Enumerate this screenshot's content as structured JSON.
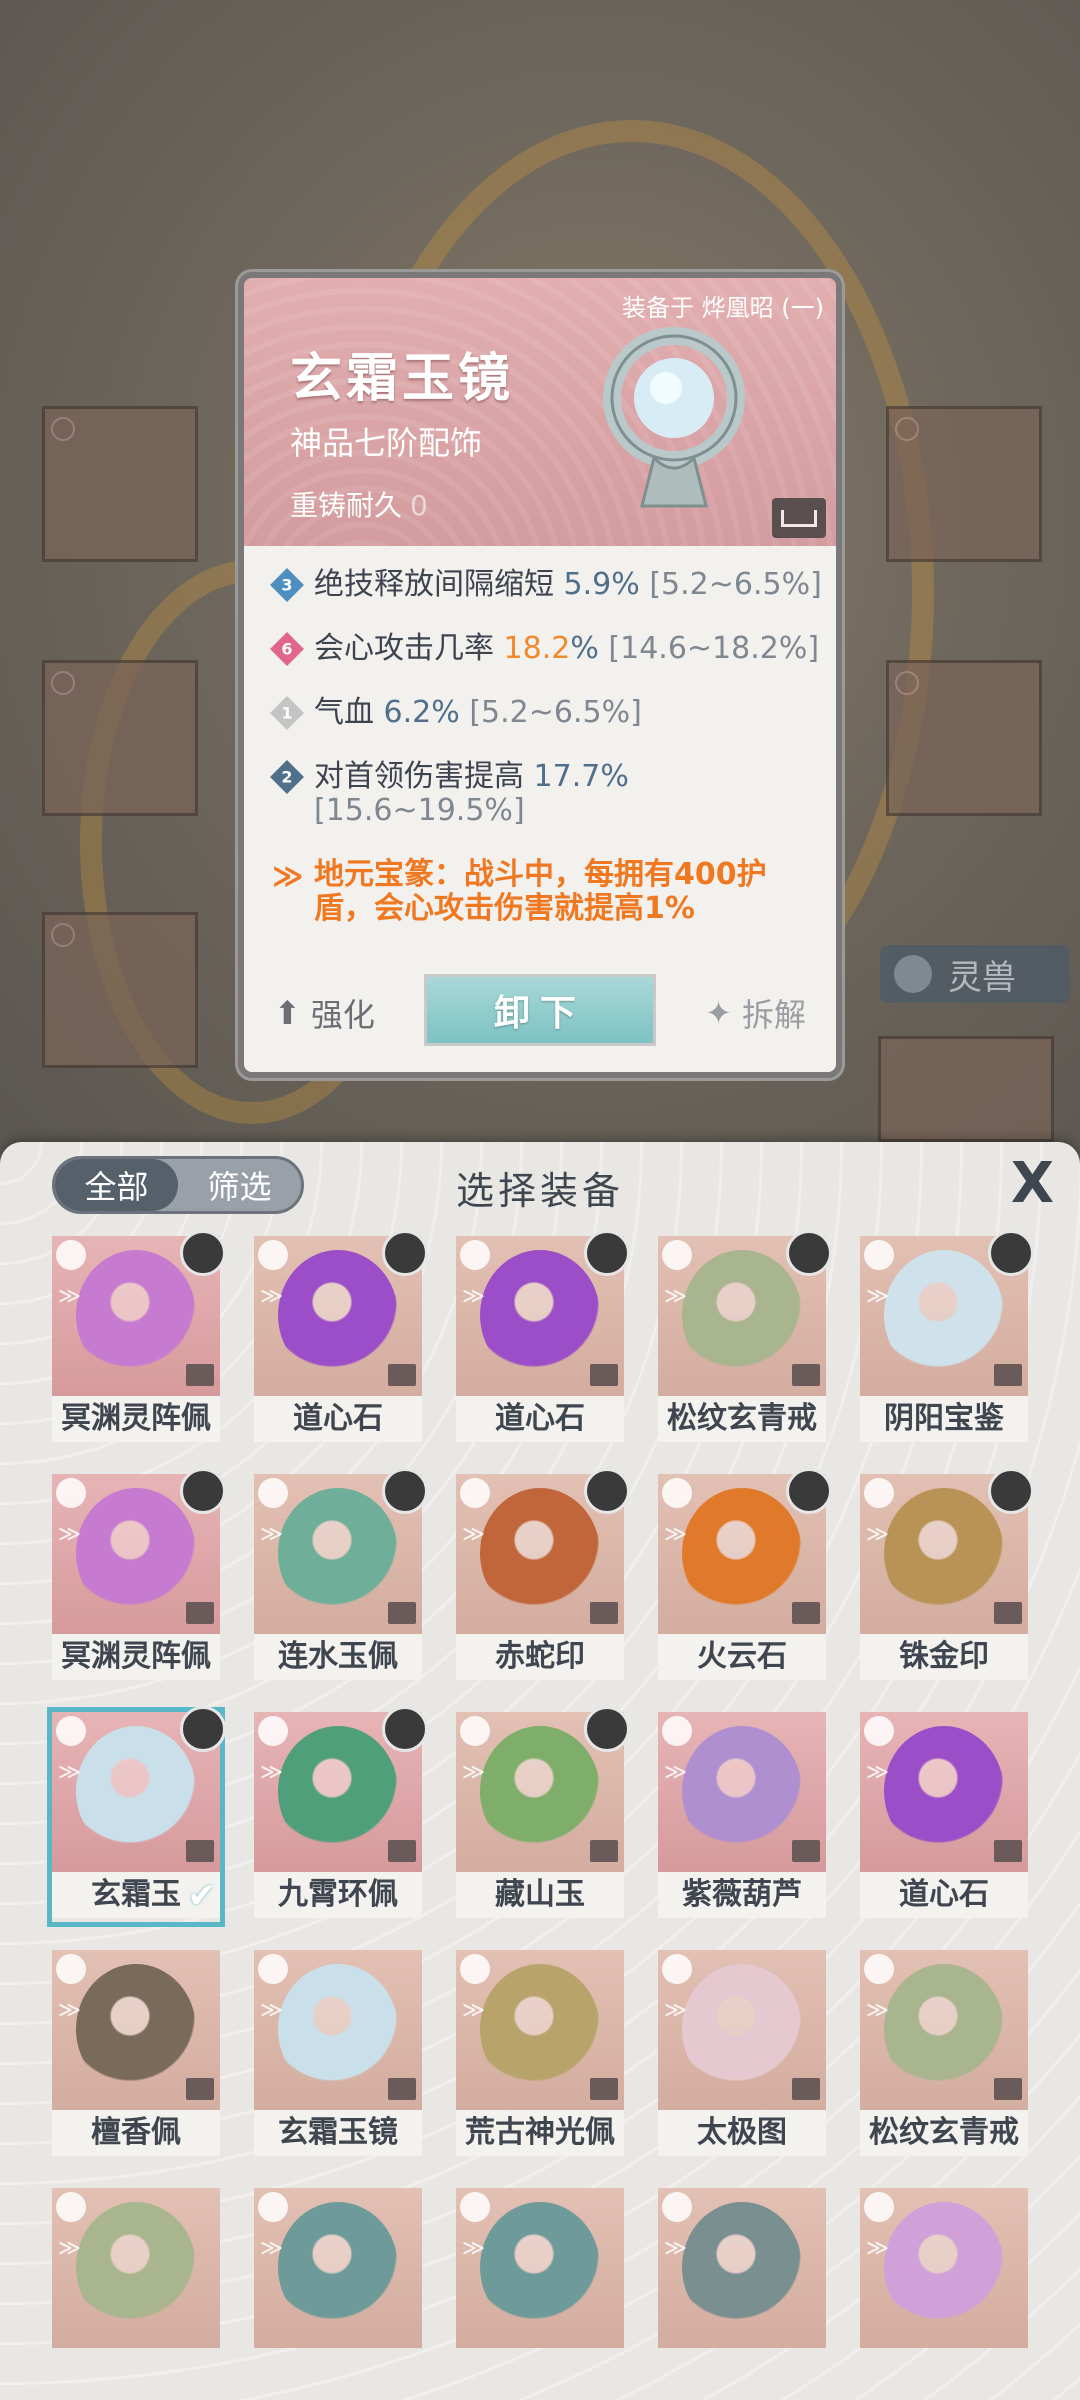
{
  "detail": {
    "equipped_on": "装备于 烨凰昭 (一)",
    "name": "玄霜玉镜",
    "grade": "神品七阶配饰",
    "recast_label": "重铸耐久",
    "recast_value": "0",
    "attributes": [
      {
        "badge": "3",
        "badge_color": "#4f8fc0",
        "label": "绝技释放间隔缩短",
        "value": "5.9%",
        "range": "[5.2~6.5%]"
      },
      {
        "badge": "6",
        "badge_color": "#e0668a",
        "label": "会心攻击几率",
        "value_hi": "18.2",
        "value_suffix": "%",
        "range": "[14.6~18.2%]"
      },
      {
        "badge": "1",
        "badge_color": "#c4c4c4",
        "label": "气血",
        "value": "6.2%",
        "range": "[5.2~6.5%]"
      },
      {
        "badge": "2",
        "badge_color": "#4f6f8a",
        "label": "对首领伤害提高",
        "value": "17.7%",
        "range": "[15.6~19.5%]"
      }
    ],
    "set_effect": "地元宝篆：战斗中，每拥有400护盾，会心攻击伤害就提高1%",
    "enhance_label": "强化",
    "unequip_label": "卸下",
    "dismantle_label": "拆解"
  },
  "background": {
    "beast_tab": "灵兽"
  },
  "panel": {
    "filter_all": "全部",
    "filter_select": "筛选",
    "title": "选择装备",
    "close": "X"
  },
  "items": [
    {
      "name": "冥渊灵阵佩",
      "bg": "pink",
      "art": "#c67ad0",
      "hero": true
    },
    {
      "name": "道心石",
      "bg": "tan",
      "art": "#9b4ec7",
      "hero": true
    },
    {
      "name": "道心石",
      "bg": "tan",
      "art": "#9b4ec7",
      "hero": true
    },
    {
      "name": "松纹玄青戒",
      "bg": "tan",
      "art": "#a8b58e",
      "hero": true
    },
    {
      "name": "阴阳宝鉴",
      "bg": "tan",
      "art": "#cfe1ea",
      "hero": true
    },
    {
      "name": "冥渊灵阵佩",
      "bg": "pink",
      "art": "#c67ad0",
      "hero": true
    },
    {
      "name": "连水玉佩",
      "bg": "tan",
      "art": "#6fae98",
      "hero": true
    },
    {
      "name": "赤蛇印",
      "bg": "tan",
      "art": "#c0663a",
      "hero": true
    },
    {
      "name": "火云石",
      "bg": "tan",
      "art": "#e07a2a",
      "hero": true
    },
    {
      "name": "铢金印",
      "bg": "tan",
      "art": "#b89355",
      "hero": true
    },
    {
      "name": "玄霜玉镜",
      "bg": "pink",
      "art": "#c9e0ea",
      "hero": true,
      "selected": true,
      "display": "玄霜玉"
    },
    {
      "name": "九霄环佩",
      "bg": "pink",
      "art": "#4fa07a",
      "hero": true
    },
    {
      "name": "藏山玉",
      "bg": "tan",
      "art": "#7fae6a",
      "hero": true
    },
    {
      "name": "紫薇葫芦",
      "bg": "pink",
      "art": "#b08fd0",
      "hero": false
    },
    {
      "name": "道心石",
      "bg": "pink",
      "art": "#9b4ec7",
      "hero": false
    },
    {
      "name": "檀香佩",
      "bg": "tan",
      "art": "#7a6a5a",
      "hero": false
    },
    {
      "name": "玄霜玉镜",
      "bg": "tan",
      "art": "#c9e0ea",
      "hero": false
    },
    {
      "name": "荒古神光佩",
      "bg": "tan",
      "art": "#b8a36a",
      "hero": false
    },
    {
      "name": "太极图",
      "bg": "tan",
      "art": "#e6c8d0",
      "hero": false
    },
    {
      "name": "松纹玄青戒",
      "bg": "tan",
      "art": "#a8b58e",
      "hero": false
    },
    {
      "name": "",
      "bg": "tan",
      "art": "#a8b58e",
      "hero": false
    },
    {
      "name": "",
      "bg": "tan",
      "art": "#6f9a9a",
      "hero": false
    },
    {
      "name": "",
      "bg": "tan",
      "art": "#6f9a9a",
      "hero": false
    },
    {
      "name": "",
      "bg": "tan",
      "art": "#7a8f90",
      "hero": false
    },
    {
      "name": "",
      "bg": "tan",
      "art": "#d0a0d8",
      "hero": false
    }
  ]
}
